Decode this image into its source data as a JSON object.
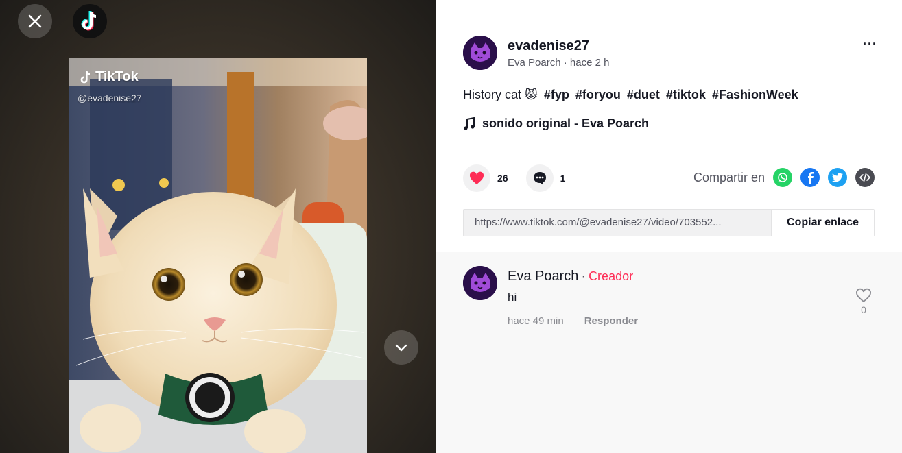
{
  "video": {
    "watermark_brand": "TikTok",
    "watermark_user": "@evadenise27"
  },
  "post": {
    "username": "evadenise27",
    "display_name": "Eva Poarch",
    "time_ago": "hace 2 h",
    "description_text": "History cat 😾",
    "hashtags": [
      "#fyp",
      "#foryou",
      "#duet",
      "#tiktok",
      "#FashionWeek"
    ],
    "music": "sonido original - Eva Poarch",
    "likes": "26",
    "comments": "1",
    "more_label": "···"
  },
  "share": {
    "label": "Compartir en",
    "platforms": [
      "whatsapp",
      "facebook",
      "twitter",
      "embed"
    ],
    "url": "https://www.tiktok.com/@evadenise27/video/703552...",
    "copy_label": "Copiar enlace"
  },
  "comment_list": [
    {
      "author": "Eva Poarch",
      "separator": "·",
      "badge": "Creador",
      "text": "hi",
      "time_ago": "hace 49 min",
      "reply_label": "Responder",
      "likes": "0"
    }
  ],
  "colors": {
    "brand_red": "#fe2c55",
    "whatsapp": "#25d366",
    "facebook": "#1877f2",
    "twitter": "#1da1f2",
    "embed": "#4a4b52"
  }
}
